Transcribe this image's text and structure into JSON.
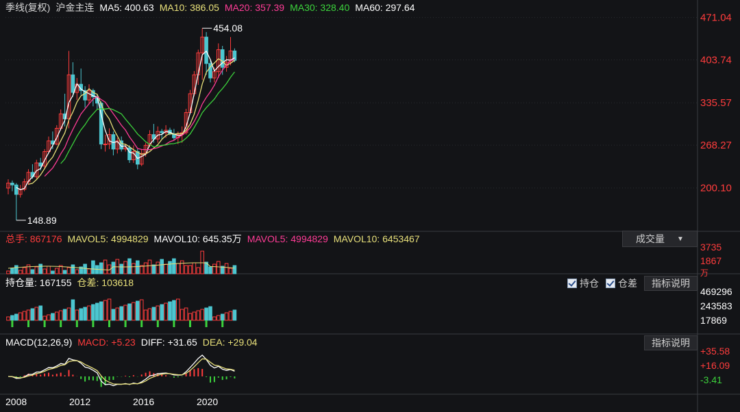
{
  "header": {
    "period": "季线(复权)",
    "symbol": "沪金主连",
    "ma": [
      {
        "label": "MA5: 400.63",
        "color": "#ffffff"
      },
      {
        "label": "MA10: 386.05",
        "color": "#e8e07a"
      },
      {
        "label": "MA20: 357.39",
        "color": "#ff3c96"
      },
      {
        "label": "MA30: 328.40",
        "color": "#3cd23c"
      },
      {
        "label": "MA60: 297.64",
        "color": "#ffffff"
      }
    ]
  },
  "price_axis": {
    "ticks": [
      "471.04",
      "403.74",
      "335.57",
      "268.27",
      "200.10"
    ],
    "max_label": "454.08",
    "min_label": "148.89"
  },
  "volume": {
    "items": [
      {
        "label": "总手: 867176",
        "color": "#ff3c3c"
      },
      {
        "label": "MAVOL5: 4994829",
        "color": "#e8e07a"
      },
      {
        "label": "MAVOL10: 645.35万",
        "color": "#ffffff"
      },
      {
        "label": "MAVOL5: 4994829",
        "color": "#ff3c96"
      },
      {
        "label": "MAVOL10: 6453467",
        "color": "#e8e07a"
      }
    ],
    "dropdown": "成交量",
    "ticks": [
      "3735",
      "1867",
      "万"
    ]
  },
  "oi": {
    "items": [
      {
        "label": "持仓量: 167155",
        "color": "#ffffff"
      },
      {
        "label": "仓差: 103618",
        "color": "#e8e07a"
      }
    ],
    "checkboxes": [
      "持仓",
      "仓差"
    ],
    "button": "指标说明",
    "ticks": [
      "469296",
      "243583",
      "17869"
    ]
  },
  "macd": {
    "items": [
      {
        "label": "MACD(12,26,9)",
        "color": "#ffffff"
      },
      {
        "label": "MACD: +5.23",
        "color": "#ff3c3c"
      },
      {
        "label": "DIFF: +31.65",
        "color": "#ffffff"
      },
      {
        "label": "DEA: +29.04",
        "color": "#e8e07a"
      }
    ],
    "button": "指标说明",
    "ticks": [
      "+35.58",
      "+16.09",
      "-3.41"
    ]
  },
  "time_axis": [
    "2008",
    "2012",
    "2016",
    "2020"
  ],
  "chart_data": {
    "type": "candlestick",
    "period": "quarterly",
    "x_start": "2008-Q1",
    "ohlc": [
      [
        200,
        214,
        190,
        208
      ],
      [
        208,
        212,
        195,
        205
      ],
      [
        205,
        208,
        148.89,
        190
      ],
      [
        190,
        205,
        185,
        198
      ],
      [
        198,
        215,
        195,
        210
      ],
      [
        210,
        230,
        205,
        225
      ],
      [
        225,
        238,
        215,
        218
      ],
      [
        218,
        245,
        215,
        240
      ],
      [
        240,
        248,
        228,
        235
      ],
      [
        235,
        262,
        232,
        258
      ],
      [
        258,
        282,
        255,
        275
      ],
      [
        275,
        290,
        262,
        270
      ],
      [
        270,
        300,
        268,
        295
      ],
      [
        295,
        325,
        292,
        318
      ],
      [
        318,
        350,
        298,
        310
      ],
      [
        310,
        418,
        295,
        380
      ],
      [
        380,
        400,
        345,
        352
      ],
      [
        352,
        375,
        340,
        365
      ],
      [
        365,
        390,
        348,
        355
      ],
      [
        355,
        362,
        328,
        340
      ],
      [
        340,
        365,
        335,
        355
      ],
      [
        355,
        358,
        330,
        345
      ],
      [
        345,
        350,
        325,
        335
      ],
      [
        335,
        338,
        262,
        270
      ],
      [
        270,
        285,
        258,
        270
      ],
      [
        270,
        295,
        262,
        285
      ],
      [
        285,
        290,
        252,
        262
      ],
      [
        262,
        280,
        255,
        275
      ],
      [
        275,
        282,
        258,
        262
      ],
      [
        262,
        270,
        258,
        264
      ],
      [
        264,
        268,
        240,
        245
      ],
      [
        245,
        268,
        240,
        258
      ],
      [
        258,
        262,
        230,
        238
      ],
      [
        238,
        262,
        235,
        255
      ],
      [
        255,
        272,
        250,
        268
      ],
      [
        268,
        292,
        265,
        285
      ],
      [
        285,
        302,
        272,
        278
      ],
      [
        278,
        298,
        272,
        290
      ],
      [
        290,
        294,
        278,
        288
      ],
      [
        288,
        300,
        280,
        292
      ],
      [
        292,
        296,
        284,
        286
      ],
      [
        286,
        294,
        276,
        280
      ],
      [
        280,
        290,
        270,
        285
      ],
      [
        285,
        298,
        272,
        288
      ],
      [
        288,
        326,
        285,
        320
      ],
      [
        320,
        356,
        318,
        350
      ],
      [
        350,
        386,
        346,
        380
      ],
      [
        380,
        420,
        364,
        415
      ],
      [
        415,
        454.08,
        372,
        440
      ],
      [
        440,
        448,
        380,
        398
      ],
      [
        398,
        404,
        368,
        375
      ],
      [
        375,
        392,
        368,
        385
      ],
      [
        385,
        430,
        375,
        420
      ],
      [
        420,
        426,
        380,
        392
      ],
      [
        392,
        410,
        385,
        400
      ],
      [
        400,
        440,
        395,
        418
      ],
      [
        418,
        422,
        400,
        403
      ]
    ],
    "ma_lines": {
      "MA5": 400.63,
      "MA10": 386.05,
      "MA20": 357.39,
      "MA30": 328.4,
      "MA60": 297.64
    },
    "ylim": [
      140,
      475
    ],
    "macd": {
      "MACD": 5.23,
      "DIFF": 31.65,
      "DEA": 29.04
    }
  }
}
